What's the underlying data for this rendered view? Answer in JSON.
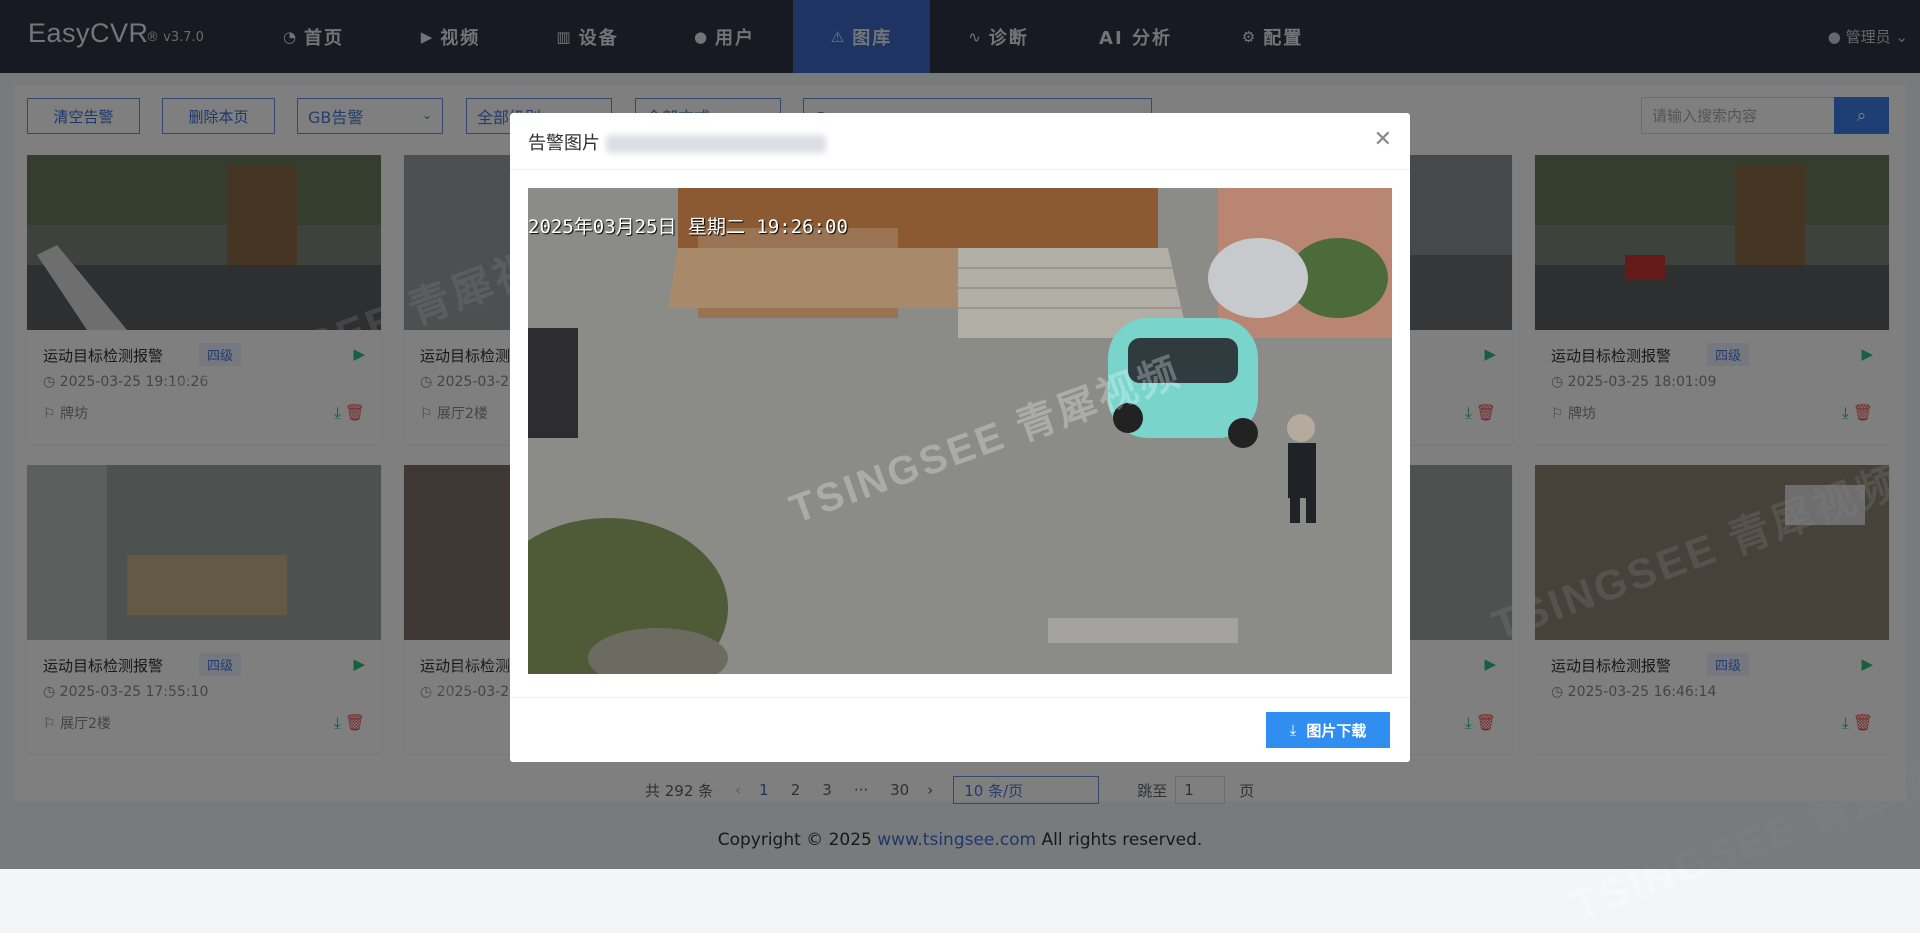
{
  "header": {
    "brand": "EasyCVR",
    "version": "® v3.7.0",
    "nav": [
      {
        "icon": "dashboard-icon",
        "glyph": "◔",
        "label": "首页"
      },
      {
        "icon": "play-circle-icon",
        "glyph": "▶",
        "label": "视频"
      },
      {
        "icon": "device-icon",
        "glyph": "▥",
        "label": "设备"
      },
      {
        "icon": "user-icon",
        "glyph": "●",
        "label": "用户"
      },
      {
        "icon": "gallery-icon",
        "glyph": "⚠",
        "label": "图库"
      },
      {
        "icon": "pulse-icon",
        "glyph": "∿",
        "label": "诊断"
      },
      {
        "icon": "",
        "glyph": "",
        "label": "AI 分析"
      },
      {
        "icon": "gear-icon",
        "glyph": "⚙",
        "label": "配置"
      }
    ],
    "active_nav": "图库",
    "user_label": "管理员"
  },
  "toolbar": {
    "clear_alarm": "清空告警",
    "delete_page": "删除本页",
    "alarm_type_select": "GB告警",
    "level_select": "全部级别",
    "method_select": "全部方式",
    "search_placeholder": "请输入搜索内容"
  },
  "cards": [
    {
      "title": "运动目标检测报警",
      "level": "四级",
      "time": "2025-03-25 19:10:26",
      "location": "牌坊"
    },
    {
      "title": "运动目标检测报警",
      "level": "",
      "time": "2025-03-2",
      "location": "展厅2楼"
    },
    {
      "title": "运动目标检测报警",
      "level": "四级",
      "time": "2025-03-25 18:01:09",
      "location": "牌坊"
    },
    {
      "title": "运动目标检测报警",
      "level": "四级",
      "time": "2025-03-25 17:55:10",
      "location": "展厅2楼"
    },
    {
      "title": "运动目标检测报警",
      "level": "",
      "time": "2025-03-2",
      "location": ""
    },
    {
      "title": "运动目标检测报警",
      "level": "四级",
      "time": "2025-03-25 16:46:14",
      "location": ""
    }
  ],
  "pagination": {
    "total": "共 292 条",
    "pages": [
      "1",
      "2",
      "3",
      "···",
      "30"
    ],
    "page_size": "10 条/页",
    "goto_label": "跳至",
    "goto_value": "1",
    "page_suffix": "页"
  },
  "footer": {
    "prefix": "Copyright © 2025 ",
    "link": "www.tsingsee.com",
    "suffix": " All rights reserved."
  },
  "dialog": {
    "title": "告警图片",
    "osd_text": "2025年03月25日 星期二 19:26:00",
    "download_label": "图片下载"
  },
  "watermark_text": "TSINGSEE 青犀视频"
}
